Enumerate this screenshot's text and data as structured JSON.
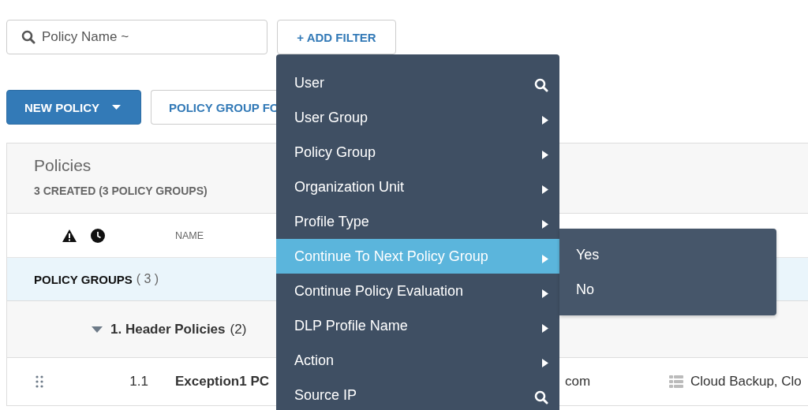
{
  "search": {
    "placeholder": "Policy Name ~"
  },
  "add_filter": {
    "label": "+ ADD FILTER"
  },
  "actions": [
    {
      "label": "NEW POLICY",
      "kind": "primary"
    },
    {
      "label": "POLICY GROUP FO",
      "kind": "secondary"
    }
  ],
  "policies": {
    "title": "Policies",
    "summary": "3 CREATED (3 POLICY GROUPS)",
    "columns": [
      "NAME"
    ],
    "group_header": {
      "label": "POLICY GROUPS",
      "count": "( 3 )"
    },
    "groups": [
      {
        "name": "1. Header Policies",
        "count": "(2)",
        "expanded": true,
        "rows": [
          {
            "number": "1.1",
            "name": "Exception1 PC",
            "source": "com",
            "destination": "Cloud Backup, Clo"
          }
        ]
      }
    ]
  },
  "filter_menu": {
    "items": [
      {
        "label": "User",
        "kind": "search",
        "selected": false
      },
      {
        "label": "User Group",
        "kind": "submenu",
        "selected": false
      },
      {
        "label": "Policy Group",
        "kind": "submenu",
        "selected": false
      },
      {
        "label": "Organization Unit",
        "kind": "submenu",
        "selected": false
      },
      {
        "label": "Profile Type",
        "kind": "submenu",
        "selected": false
      },
      {
        "label": "Continue To Next Policy Group",
        "kind": "submenu",
        "selected": true
      },
      {
        "label": "Continue Policy Evaluation",
        "kind": "submenu",
        "selected": false
      },
      {
        "label": "DLP Profile Name",
        "kind": "submenu",
        "selected": false
      },
      {
        "label": "Action",
        "kind": "submenu",
        "selected": false
      },
      {
        "label": "Source IP",
        "kind": "search",
        "selected": false
      }
    ]
  },
  "submenu": {
    "items": [
      {
        "label": "Yes"
      },
      {
        "label": "No"
      }
    ]
  }
}
